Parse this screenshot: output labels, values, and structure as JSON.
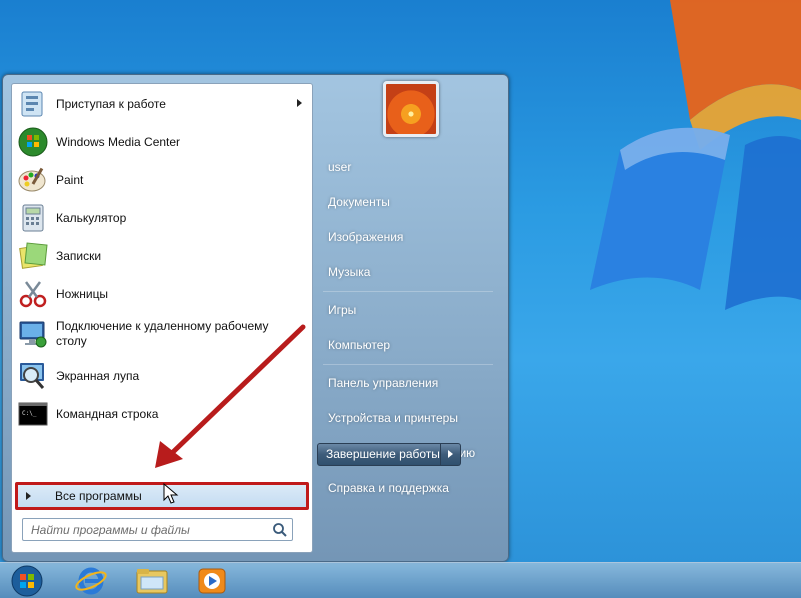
{
  "start_menu": {
    "programs": [
      {
        "label": "Приступая к работе",
        "icon": "getting-started-icon",
        "submenu": true
      },
      {
        "label": "Windows Media Center",
        "icon": "windows-media-center-icon"
      },
      {
        "label": "Paint",
        "icon": "paint-icon"
      },
      {
        "label": "Калькулятор",
        "icon": "calculator-icon"
      },
      {
        "label": "Записки",
        "icon": "sticky-notes-icon"
      },
      {
        "label": "Ножницы",
        "icon": "snipping-tool-icon"
      },
      {
        "label": "Подключение к удаленному рабочему столу",
        "icon": "remote-desktop-icon"
      },
      {
        "label": "Экранная лупа",
        "icon": "magnifier-icon"
      },
      {
        "label": "Командная строка",
        "icon": "command-prompt-icon"
      }
    ],
    "all_programs_label": "Все программы",
    "search_placeholder": "Найти программы и файлы",
    "places": [
      {
        "label": "user"
      },
      {
        "label": "Документы"
      },
      {
        "label": "Изображения"
      },
      {
        "label": "Музыка"
      },
      {
        "label": "Игры"
      },
      {
        "label": "Компьютер"
      },
      {
        "label": "Панель управления"
      },
      {
        "label": "Устройства и принтеры"
      },
      {
        "label": "Программы по умолчанию"
      },
      {
        "label": "Справка и поддержка"
      }
    ],
    "shutdown_label": "Завершение работы"
  },
  "taskbar": {
    "items": [
      {
        "icon": "start-orb-icon"
      },
      {
        "icon": "internet-explorer-icon"
      },
      {
        "icon": "windows-explorer-icon"
      },
      {
        "icon": "media-player-icon"
      }
    ]
  },
  "colors": {
    "highlight_border": "#c01a1a",
    "annotation_arrow": "#b81c1c",
    "desktop_blue": "#2b9be2"
  }
}
